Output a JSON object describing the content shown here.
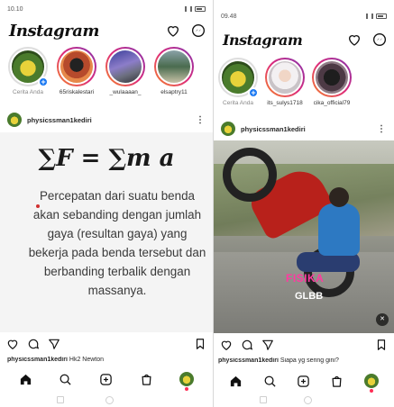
{
  "left_phone": {
    "status": {
      "time": "10.10",
      "signal": "ıl ᵃıl"
    },
    "logo": "Instagram",
    "stories": [
      {
        "label": "Cerita Anda",
        "avatar": "plant-avatar",
        "muted": true
      },
      {
        "label": "65riskalestari",
        "avatar": "bike-avatar",
        "muted": false
      },
      {
        "label": "_wulaaaan_",
        "avatar": "sky-avatar",
        "muted": false
      },
      {
        "label": "elsaptry11",
        "avatar": "street-avatar",
        "muted": false
      }
    ],
    "post": {
      "username": "physicssman1kediri",
      "formula": "∑F = ∑m a",
      "text": "Percepatan dari suatu benda akan sebanding dengan jumlah gaya (resultan gaya) yang bekerja pada benda tersebut dan berbanding terbalik dengan massanya.",
      "caption_user": "physicssman1kediri",
      "caption_text": "Hk2 Newton"
    }
  },
  "right_phone": {
    "status": {
      "time": "09.48",
      "signal": "ıl ᵃıl"
    },
    "logo": "Instagram",
    "stories": [
      {
        "label": "Cerita Anda",
        "avatar": "plant-avatar",
        "muted": true
      },
      {
        "label": "its_sulys1718",
        "avatar": "hijab-avatar",
        "muted": false
      },
      {
        "label": "cika_official79",
        "avatar": "black-avatar",
        "muted": false
      }
    ],
    "post": {
      "username": "physicssman1kediri",
      "overlay_brand": "FISIKA",
      "overlay_title": "GLBB",
      "caption_user": "physicssman1kediri",
      "caption_text": "Siapa yg sering gini?"
    }
  },
  "icons": {
    "heart": "heart-icon",
    "messenger": "messenger-icon",
    "comment": "comment-icon",
    "share": "share-icon",
    "save": "bookmark-icon",
    "home": "home-icon",
    "search": "search-icon",
    "add": "add-post-icon",
    "shop": "shop-icon"
  },
  "colors": {
    "story_ring_start": "#f58529",
    "story_ring_mid": "#dd2a7b",
    "story_ring_end": "#8134af",
    "badge_blue": "#1877f2",
    "nav_dot": "#ff2d55"
  }
}
